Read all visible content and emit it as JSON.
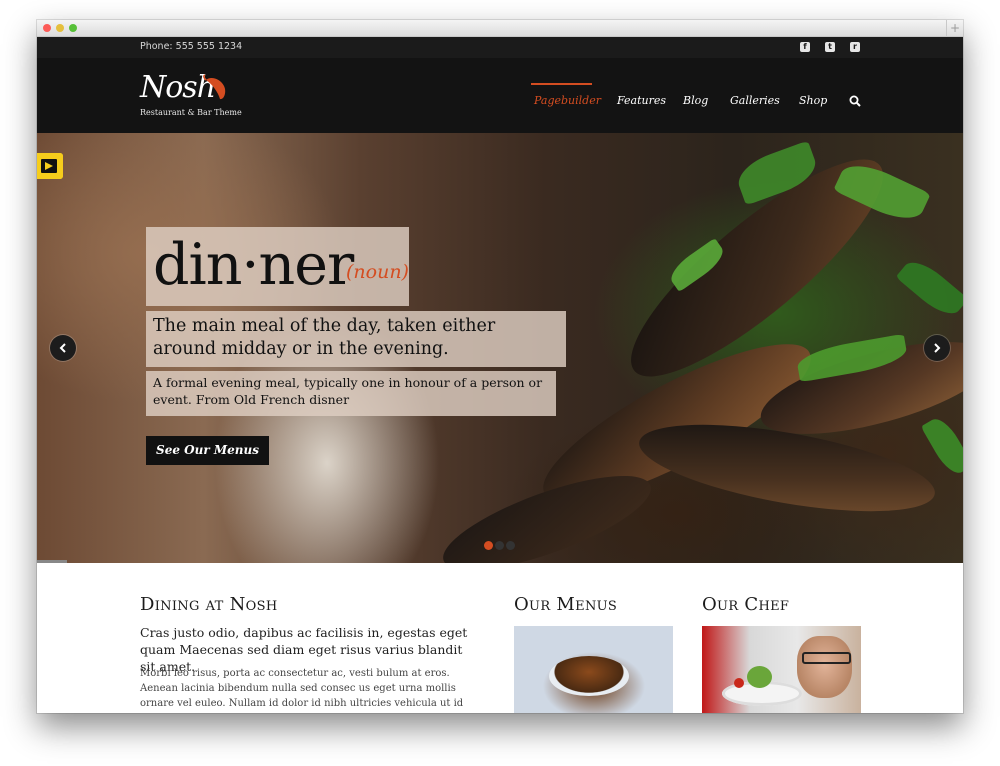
{
  "topbar": {
    "phone": "Phone: 555 555 1234",
    "social": [
      {
        "name": "facebook-icon",
        "glyph": "f"
      },
      {
        "name": "twitter-icon",
        "glyph": "t"
      },
      {
        "name": "rss-icon",
        "glyph": "r"
      }
    ]
  },
  "brand": {
    "logo": "Nosh",
    "tagline": "Restaurant & Bar Theme",
    "accent": "#d44d21"
  },
  "nav": {
    "items": [
      "Pagebuilder",
      "Features",
      "Blog",
      "Galleries",
      "Shop"
    ],
    "active": "Pagebuilder",
    "search_icon": "search-icon"
  },
  "hero": {
    "word": "din·ner",
    "part_of_speech": "(noun)",
    "definition": "The main meal of the day, taken either around midday or in the evening.",
    "subtext": "A formal evening meal, typically one in honour of a person or event. From Old French disner",
    "cta": "See Our Menus",
    "slides": 3,
    "active_slide": 1
  },
  "sections": {
    "dining": {
      "title": "Dining at Nosh",
      "lead": "Cras justo odio, dapibus ac facilisis in, egestas eget quam Maecenas sed diam eget risus varius blandit sit amet.",
      "body": "Morbi leo risus, porta ac consectetur ac, vesti bulum at eros. Aenean lacinia bibendum nulla sed consec us eget urna mollis ornare vel euleo. Nullam id dolor id nibh ultricies vehicula ut id elit. Cum sociis natoque penatibus et"
    },
    "menus": {
      "title": "Our Menus"
    },
    "chef": {
      "title": "Our Chef"
    }
  }
}
